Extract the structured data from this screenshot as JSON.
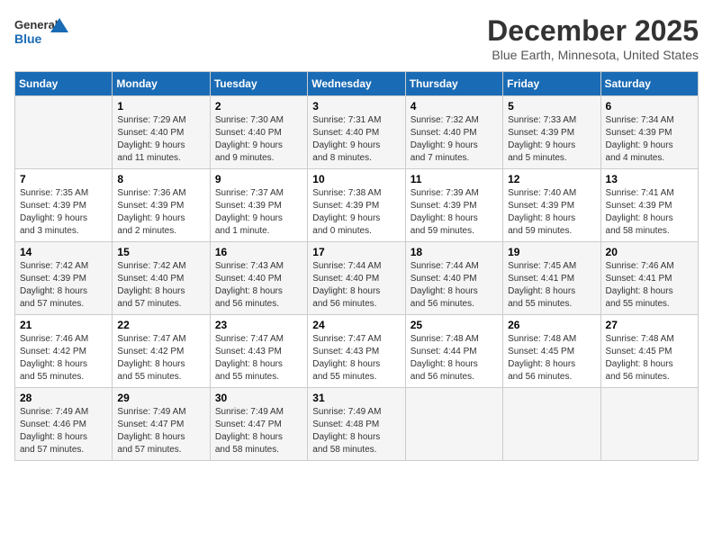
{
  "logo": {
    "line1": "General",
    "line2": "Blue"
  },
  "title": "December 2025",
  "subtitle": "Blue Earth, Minnesota, United States",
  "days_of_week": [
    "Sunday",
    "Monday",
    "Tuesday",
    "Wednesday",
    "Thursday",
    "Friday",
    "Saturday"
  ],
  "weeks": [
    [
      {
        "day": "",
        "info": ""
      },
      {
        "day": "1",
        "info": "Sunrise: 7:29 AM\nSunset: 4:40 PM\nDaylight: 9 hours\nand 11 minutes."
      },
      {
        "day": "2",
        "info": "Sunrise: 7:30 AM\nSunset: 4:40 PM\nDaylight: 9 hours\nand 9 minutes."
      },
      {
        "day": "3",
        "info": "Sunrise: 7:31 AM\nSunset: 4:40 PM\nDaylight: 9 hours\nand 8 minutes."
      },
      {
        "day": "4",
        "info": "Sunrise: 7:32 AM\nSunset: 4:40 PM\nDaylight: 9 hours\nand 7 minutes."
      },
      {
        "day": "5",
        "info": "Sunrise: 7:33 AM\nSunset: 4:39 PM\nDaylight: 9 hours\nand 5 minutes."
      },
      {
        "day": "6",
        "info": "Sunrise: 7:34 AM\nSunset: 4:39 PM\nDaylight: 9 hours\nand 4 minutes."
      }
    ],
    [
      {
        "day": "7",
        "info": "Sunrise: 7:35 AM\nSunset: 4:39 PM\nDaylight: 9 hours\nand 3 minutes."
      },
      {
        "day": "8",
        "info": "Sunrise: 7:36 AM\nSunset: 4:39 PM\nDaylight: 9 hours\nand 2 minutes."
      },
      {
        "day": "9",
        "info": "Sunrise: 7:37 AM\nSunset: 4:39 PM\nDaylight: 9 hours\nand 1 minute."
      },
      {
        "day": "10",
        "info": "Sunrise: 7:38 AM\nSunset: 4:39 PM\nDaylight: 9 hours\nand 0 minutes."
      },
      {
        "day": "11",
        "info": "Sunrise: 7:39 AM\nSunset: 4:39 PM\nDaylight: 8 hours\nand 59 minutes."
      },
      {
        "day": "12",
        "info": "Sunrise: 7:40 AM\nSunset: 4:39 PM\nDaylight: 8 hours\nand 59 minutes."
      },
      {
        "day": "13",
        "info": "Sunrise: 7:41 AM\nSunset: 4:39 PM\nDaylight: 8 hours\nand 58 minutes."
      }
    ],
    [
      {
        "day": "14",
        "info": "Sunrise: 7:42 AM\nSunset: 4:39 PM\nDaylight: 8 hours\nand 57 minutes."
      },
      {
        "day": "15",
        "info": "Sunrise: 7:42 AM\nSunset: 4:40 PM\nDaylight: 8 hours\nand 57 minutes."
      },
      {
        "day": "16",
        "info": "Sunrise: 7:43 AM\nSunset: 4:40 PM\nDaylight: 8 hours\nand 56 minutes."
      },
      {
        "day": "17",
        "info": "Sunrise: 7:44 AM\nSunset: 4:40 PM\nDaylight: 8 hours\nand 56 minutes."
      },
      {
        "day": "18",
        "info": "Sunrise: 7:44 AM\nSunset: 4:40 PM\nDaylight: 8 hours\nand 56 minutes."
      },
      {
        "day": "19",
        "info": "Sunrise: 7:45 AM\nSunset: 4:41 PM\nDaylight: 8 hours\nand 55 minutes."
      },
      {
        "day": "20",
        "info": "Sunrise: 7:46 AM\nSunset: 4:41 PM\nDaylight: 8 hours\nand 55 minutes."
      }
    ],
    [
      {
        "day": "21",
        "info": "Sunrise: 7:46 AM\nSunset: 4:42 PM\nDaylight: 8 hours\nand 55 minutes."
      },
      {
        "day": "22",
        "info": "Sunrise: 7:47 AM\nSunset: 4:42 PM\nDaylight: 8 hours\nand 55 minutes."
      },
      {
        "day": "23",
        "info": "Sunrise: 7:47 AM\nSunset: 4:43 PM\nDaylight: 8 hours\nand 55 minutes."
      },
      {
        "day": "24",
        "info": "Sunrise: 7:47 AM\nSunset: 4:43 PM\nDaylight: 8 hours\nand 55 minutes."
      },
      {
        "day": "25",
        "info": "Sunrise: 7:48 AM\nSunset: 4:44 PM\nDaylight: 8 hours\nand 56 minutes."
      },
      {
        "day": "26",
        "info": "Sunrise: 7:48 AM\nSunset: 4:45 PM\nDaylight: 8 hours\nand 56 minutes."
      },
      {
        "day": "27",
        "info": "Sunrise: 7:48 AM\nSunset: 4:45 PM\nDaylight: 8 hours\nand 56 minutes."
      }
    ],
    [
      {
        "day": "28",
        "info": "Sunrise: 7:49 AM\nSunset: 4:46 PM\nDaylight: 8 hours\nand 57 minutes."
      },
      {
        "day": "29",
        "info": "Sunrise: 7:49 AM\nSunset: 4:47 PM\nDaylight: 8 hours\nand 57 minutes."
      },
      {
        "day": "30",
        "info": "Sunrise: 7:49 AM\nSunset: 4:47 PM\nDaylight: 8 hours\nand 58 minutes."
      },
      {
        "day": "31",
        "info": "Sunrise: 7:49 AM\nSunset: 4:48 PM\nDaylight: 8 hours\nand 58 minutes."
      },
      {
        "day": "",
        "info": ""
      },
      {
        "day": "",
        "info": ""
      },
      {
        "day": "",
        "info": ""
      }
    ]
  ]
}
